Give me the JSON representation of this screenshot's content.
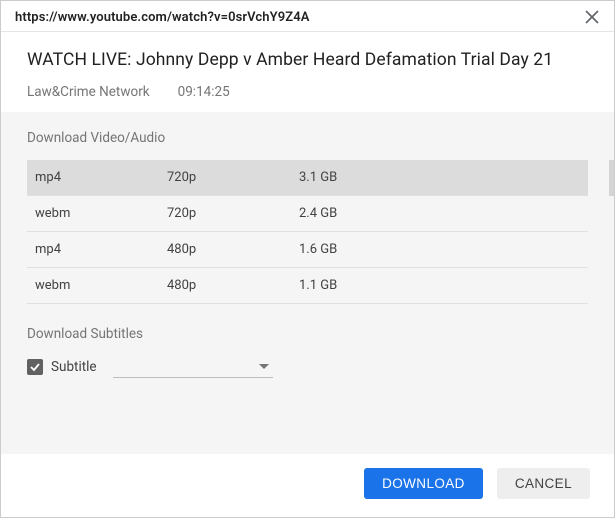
{
  "url": "https://www.youtube.com/watch?v=0srVchY9Z4A",
  "video": {
    "title": "WATCH LIVE: Johnny Depp v Amber Heard Defamation Trial Day 21",
    "channel": "Law&Crime Network",
    "duration": "09:14:25"
  },
  "sections": {
    "formats_title": "Download Video/Audio",
    "subtitles_title": "Download Subtitles"
  },
  "formats": [
    {
      "container": "mp4",
      "quality": "720p",
      "size": "3.1 GB"
    },
    {
      "container": "webm",
      "quality": "720p",
      "size": "2.4 GB"
    },
    {
      "container": "mp4",
      "quality": "480p",
      "size": "1.6 GB"
    },
    {
      "container": "webm",
      "quality": "480p",
      "size": "1.1 GB"
    }
  ],
  "subtitle": {
    "checkbox_checked": true,
    "label": "Subtitle"
  },
  "buttons": {
    "download": "DOWNLOAD",
    "cancel": "CANCEL"
  }
}
